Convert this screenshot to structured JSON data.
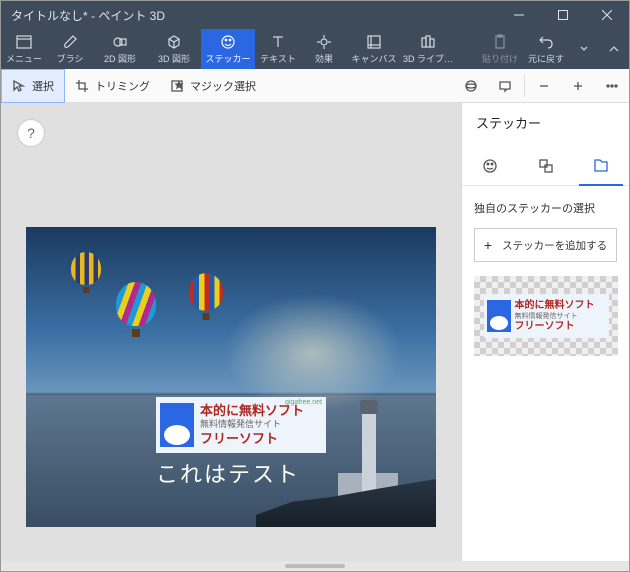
{
  "window": {
    "title": "タイトルなし* - ペイント 3D"
  },
  "ribbon": {
    "menu": "メニュー",
    "brush": "ブラシ",
    "shape2d": "2D 図形",
    "shape3d": "3D 図形",
    "sticker": "ステッカー",
    "text": "テキスト",
    "effects": "効果",
    "canvas": "キャンバス",
    "lib3d": "3D ライブ…",
    "paste": "貼り付け",
    "undo": "元に戻す"
  },
  "toolbar": {
    "select": "選択",
    "trim": "トリミング",
    "magic": "マジック選択"
  },
  "help_label": "?",
  "canvas_text": "これはテスト",
  "sticker_logo": {
    "line1": "本的に無料ソフト",
    "line2": "フリーソフト",
    "sub": "無料情報発信サイト",
    "corner": "gigafree.net"
  },
  "panel": {
    "title": "ステッカー",
    "section_label": "独自のステッカーの選択",
    "add_button": "ステッカーを追加する"
  }
}
